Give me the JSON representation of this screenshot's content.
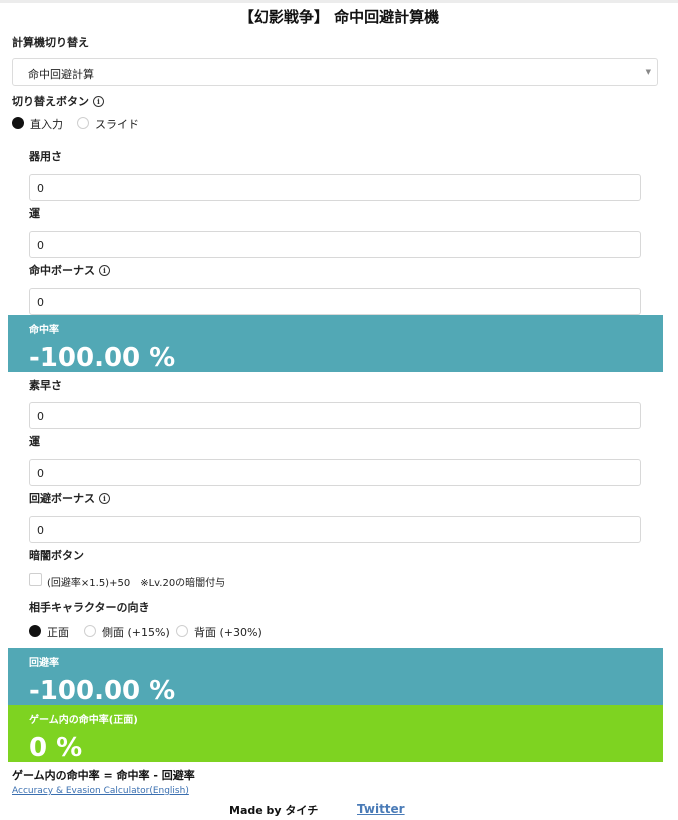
{
  "title": "【幻影戦争】 命中回避計算機",
  "calc_switch": {
    "label": "計算機切り替え",
    "selected": "命中回避計算"
  },
  "toggle": {
    "label": "切り替えボタン",
    "options": [
      "直入力",
      "スライド"
    ],
    "selected": "直入力"
  },
  "accuracy": {
    "dex_label": "器用さ",
    "dex_value": "0",
    "luck_label": "運",
    "luck_value": "0",
    "bonus_label": "命中ボーナス",
    "bonus_value": "0"
  },
  "hit_rate": {
    "label": "命中率",
    "value": "-100.00 %"
  },
  "evasion": {
    "agi_label": "素早さ",
    "agi_value": "0",
    "luck_label": "運",
    "luck_value": "0",
    "bonus_label": "回避ボーナス",
    "bonus_value": "0"
  },
  "dark": {
    "label": "暗闇ボタン",
    "checkbox_text": "(回避率×1.5)+50　※Lv.20の暗闇付与",
    "checked": false
  },
  "direction": {
    "label": "相手キャラクターの向き",
    "options": [
      "正面",
      "側面 (+15%)",
      "背面 (+30%)"
    ],
    "selected": "正面"
  },
  "evade_rate": {
    "label": "回避率",
    "value": "-100.00 %"
  },
  "game_hit": {
    "label": "ゲーム内の命中率(正面)",
    "value": "0 %"
  },
  "formula": "ゲーム内の命中率 = 命中率 - 回避率",
  "english_link": "Accuracy & Evasion Calculator(English)",
  "made_by": "Made by タイチ",
  "twitter": "Twitter",
  "colors": {
    "teal_band": "#52a8b5",
    "green_band": "#7ed321"
  }
}
